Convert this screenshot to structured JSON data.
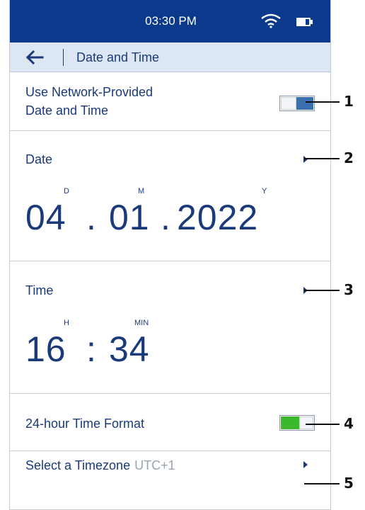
{
  "status_bar": {
    "time": "03:30 PM",
    "wifi_icon": "wifi-icon",
    "battery_icon": "battery-icon"
  },
  "nav": {
    "back_icon": "arrow-left-icon",
    "title": "Date and Time"
  },
  "network_time": {
    "label_line1": "Use Network-Provided",
    "label_line2": "Date and Time",
    "enabled": true
  },
  "date": {
    "label": "Date",
    "day_label": "D",
    "month_label": "M",
    "year_label": "Y",
    "day": "04",
    "sep1": ".",
    "month": "01",
    "sep2": ".",
    "year": "2022"
  },
  "time": {
    "label": "Time",
    "hour_label": "H",
    "minute_label": "MIN",
    "hour": "16",
    "sep": ":",
    "minute": "34"
  },
  "format_24h": {
    "label": "24-hour Time Format",
    "enabled": true,
    "accent": "#3cb82c"
  },
  "timezone": {
    "label": "Select a Timezone",
    "value": "UTC+1"
  },
  "callouts": [
    "1",
    "2",
    "3",
    "4",
    "5"
  ],
  "colors": {
    "header": "#0b3a8c",
    "nav_bg": "#dde6f3",
    "text": "#1a3a7a",
    "toggle_blue": "#3a6fb0",
    "toggle_green": "#3cb82c"
  }
}
